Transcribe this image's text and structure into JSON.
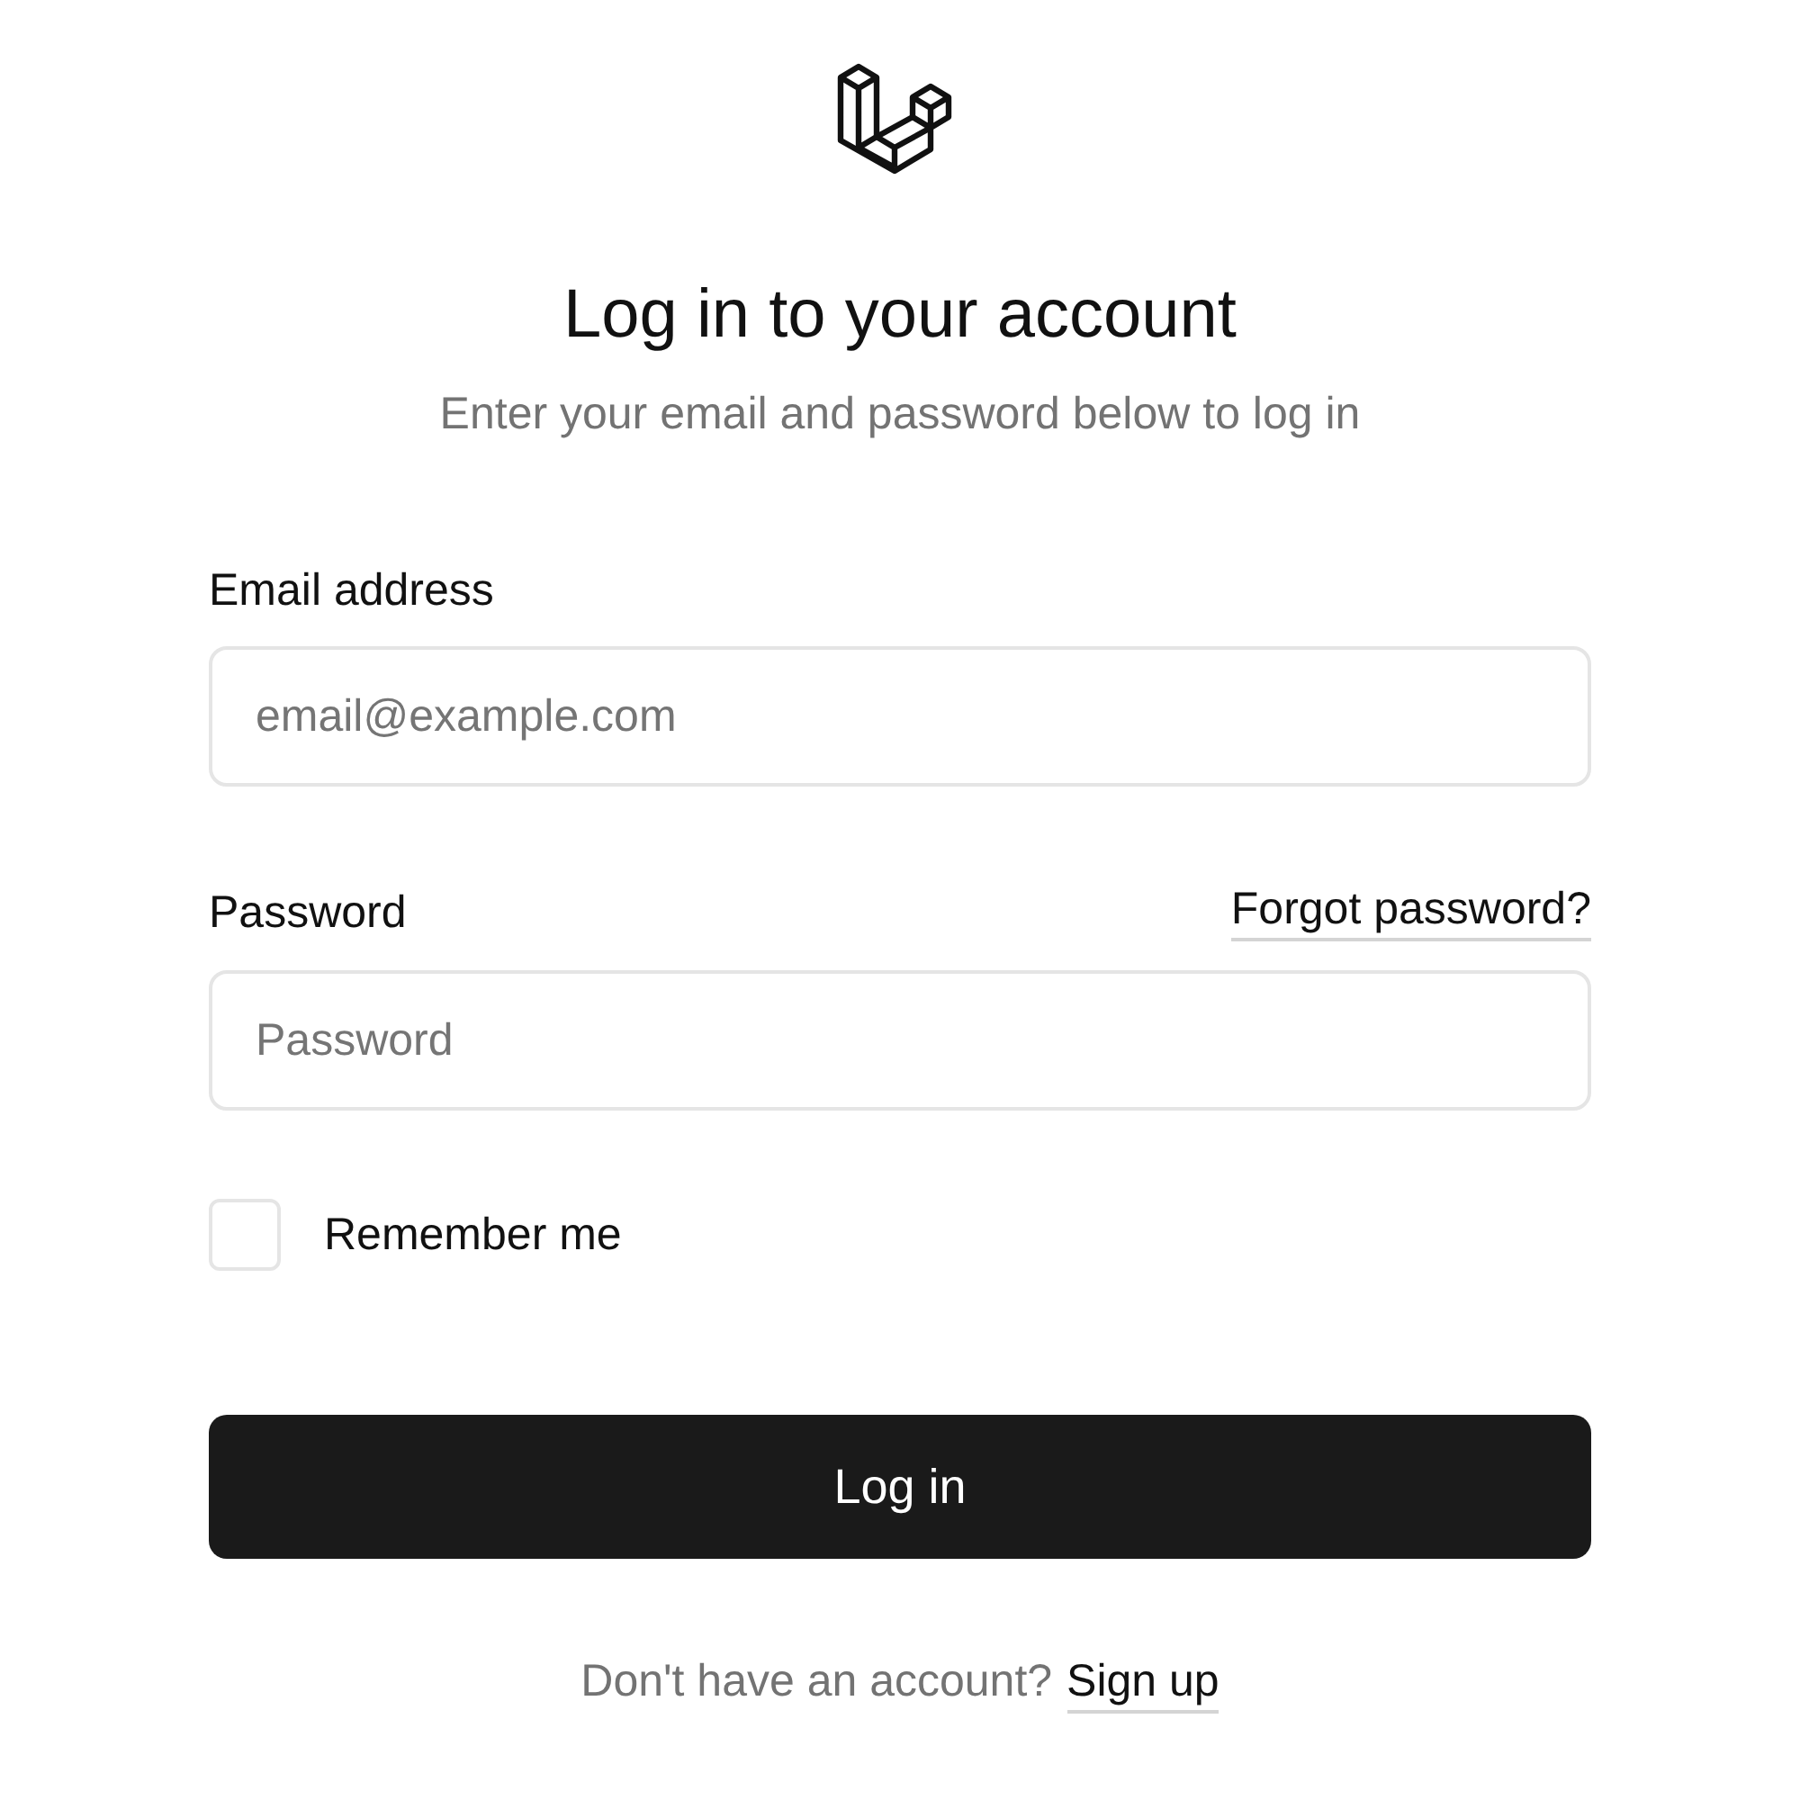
{
  "title": "Log in to your account",
  "subtitle": "Enter your email and password below to log in",
  "email": {
    "label": "Email address",
    "placeholder": "email@example.com"
  },
  "password": {
    "label": "Password",
    "forgot_link": "Forgot password?",
    "placeholder": "Password"
  },
  "remember": {
    "label": "Remember me",
    "checked": false
  },
  "submit": "Log in",
  "footer": {
    "text": "Don't have an account?",
    "link": "Sign up"
  }
}
